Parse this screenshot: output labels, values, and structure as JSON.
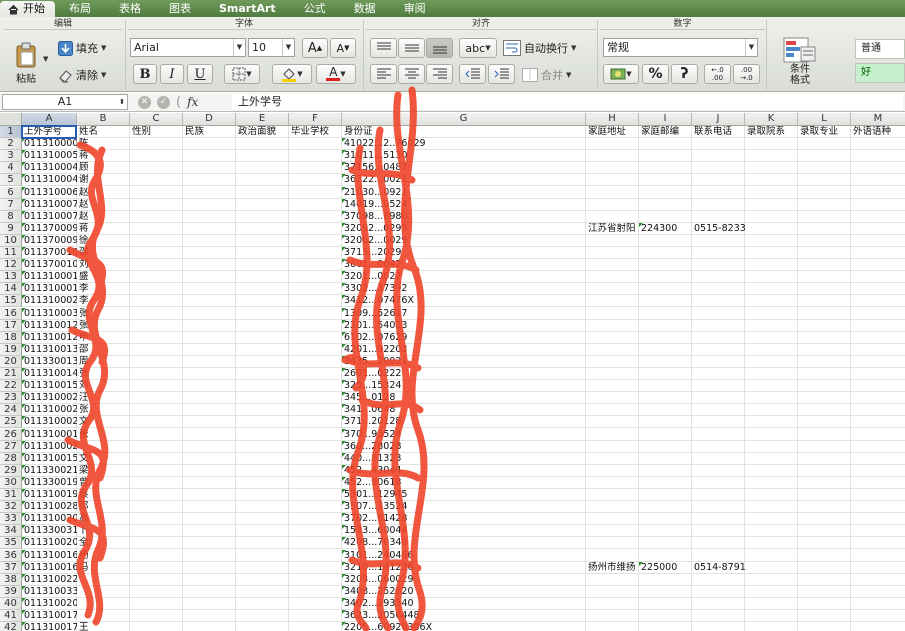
{
  "tabs": [
    {
      "label": "开始",
      "active": true
    },
    {
      "label": "布局"
    },
    {
      "label": "表格"
    },
    {
      "label": "图表"
    },
    {
      "label": "SmartArt",
      "bold": true
    },
    {
      "label": "公式"
    },
    {
      "label": "数据"
    },
    {
      "label": "审阅"
    }
  ],
  "ribbon": {
    "groups": {
      "edit": "编辑",
      "font": "字体",
      "align": "对齐",
      "number": "数字"
    },
    "paste_label": "粘贴",
    "fill_label": "填充",
    "clear_label": "清除",
    "font_name": "Arial",
    "font_size": "10",
    "grow_label": "A",
    "shrink_label": "A",
    "bold_label": "B",
    "italic_label": "I",
    "underline_label": "U",
    "fontcolor_label": "A",
    "abc_label": "abc",
    "wrap_label": "自动换行",
    "merge_label": "合并",
    "number_format": "常规",
    "percent_label": "%",
    "comma_label": "ʔ",
    "dec_inc_label": "←.0 .00",
    "dec_dec_label": ".00 →.0",
    "cond_format_label": "条件格式",
    "style_normal": "普通",
    "style_good": "好"
  },
  "formula_bar": {
    "cell_ref": "A1",
    "fx": "fx",
    "content": "上外学号"
  },
  "columns": [
    "A",
    "B",
    "C",
    "D",
    "E",
    "F",
    "G",
    "H",
    "I",
    "J",
    "K",
    "L",
    "M"
  ],
  "headers": {
    "A": "上外学号",
    "B": "姓名",
    "C": "性别",
    "D": "民族",
    "E": "政治面貌",
    "F": "毕业学校",
    "G": "身份证",
    "H": "家庭地址",
    "I": "家庭邮编",
    "J": "联系电话",
    "K": "录取院系",
    "L": "录取专业",
    "M": "外语语种"
  },
  "rows": [
    {
      "n": "2",
      "a": "011310000",
      "b": "陈",
      "g": "41022...2..76029"
    },
    {
      "n": "3",
      "a": "011310005",
      "b": "蒋",
      "g": "31011...5130"
    },
    {
      "n": "4",
      "a": "011310004",
      "b": "顾",
      "g": "37156...0487"
    },
    {
      "n": "5",
      "a": "011310004",
      "b": "谢",
      "g": "36222...0021"
    },
    {
      "n": "6",
      "a": "011310006",
      "b": "赵",
      "g": "21030...0921"
    },
    {
      "n": "7",
      "a": "011310007",
      "b": "赵",
      "g": "14019...0524"
    },
    {
      "n": "8",
      "a": "011310007",
      "b": "赵",
      "g": "37098...6980"
    },
    {
      "n": "9",
      "a": "011370009",
      "b": "蒋",
      "g": "32092...0295",
      "h": "江苏省射阳",
      "i": "224300",
      "j": "0515-8233"
    },
    {
      "n": "10",
      "a": "011370009",
      "b": "徐",
      "g": "32062...0029"
    },
    {
      "n": "11",
      "a": "011370010",
      "b": "邵",
      "g": "3715...2029"
    },
    {
      "n": "12",
      "a": "011370010",
      "b": "刘",
      "g": "3601...0042"
    },
    {
      "n": "13",
      "a": "011310001",
      "b": "盛",
      "g": "3201...0027"
    },
    {
      "n": "14",
      "a": "011310001",
      "b": "李",
      "g": "3302...37392"
    },
    {
      "n": "15",
      "a": "011310002",
      "b": "李",
      "g": "3412...07476X"
    },
    {
      "n": "16",
      "a": "011310003",
      "b": "张",
      "g": "1309...52617"
    },
    {
      "n": "17",
      "a": "011310012",
      "b": "张",
      "g": "2201...54023"
    },
    {
      "n": "18",
      "a": "011310012",
      "b": "申",
      "g": "6102...07629"
    },
    {
      "n": "19",
      "a": "011310013",
      "b": "邵",
      "g": "4201...92203"
    },
    {
      "n": "20",
      "a": "011330013",
      "b": "周",
      "g": "3435...20021"
    },
    {
      "n": "21",
      "a": "011310014",
      "b": "张",
      "g": "2601...0222"
    },
    {
      "n": "22",
      "a": "011310015",
      "b": "刘",
      "g": "325...15324"
    },
    {
      "n": "23",
      "a": "011310002",
      "b": "汪",
      "g": "345...0128"
    },
    {
      "n": "24",
      "a": "011310002",
      "b": "张",
      "g": "341...0648"
    },
    {
      "n": "25",
      "a": "011310002",
      "b": "文",
      "g": "371...20128"
    },
    {
      "n": "26",
      "a": "011310001",
      "b": "张",
      "g": "370...93524"
    },
    {
      "n": "27",
      "a": "011310002",
      "b": "",
      "g": "360...28028"
    },
    {
      "n": "28",
      "a": "011310015",
      "b": "文",
      "g": "440...81323"
    },
    {
      "n": "29",
      "a": "011330021",
      "b": "梁",
      "g": "452...43044"
    },
    {
      "n": "30",
      "a": "011330019",
      "b": "曾",
      "g": "452...90618"
    },
    {
      "n": "31",
      "a": "011310019",
      "b": "蔡",
      "g": "5301...12945"
    },
    {
      "n": "32",
      "a": "011310028",
      "b": "邵",
      "g": "3507...33524"
    },
    {
      "n": "33",
      "a": "011310020",
      "b": "高",
      "g": "3702...81428"
    },
    {
      "n": "34",
      "a": "011330031",
      "b": "卜",
      "g": "1523...60044"
    },
    {
      "n": "35",
      "a": "011310020",
      "b": "全",
      "g": "4208...70340"
    },
    {
      "n": "36",
      "a": "011310016",
      "b": "杨",
      "g": "3101...240466"
    },
    {
      "n": "37",
      "a": "011310016",
      "b": "冯",
      "g": "3210...141226",
      "h": "扬州市维扬",
      "i": "225000",
      "j": "0514-8791"
    },
    {
      "n": "38",
      "a": "011310022",
      "b": "",
      "g": "3203...060029"
    },
    {
      "n": "39",
      "a": "011310033",
      "b": "",
      "g": "3408...252820"
    },
    {
      "n": "40",
      "a": "011310020",
      "b": "",
      "g": "3402...293340"
    },
    {
      "n": "41",
      "a": "011310017",
      "b": "",
      "g": "3623...2056448"
    },
    {
      "n": "42",
      "a": "011310017",
      "b": "王",
      "g": "2205...60928306X"
    }
  ]
}
